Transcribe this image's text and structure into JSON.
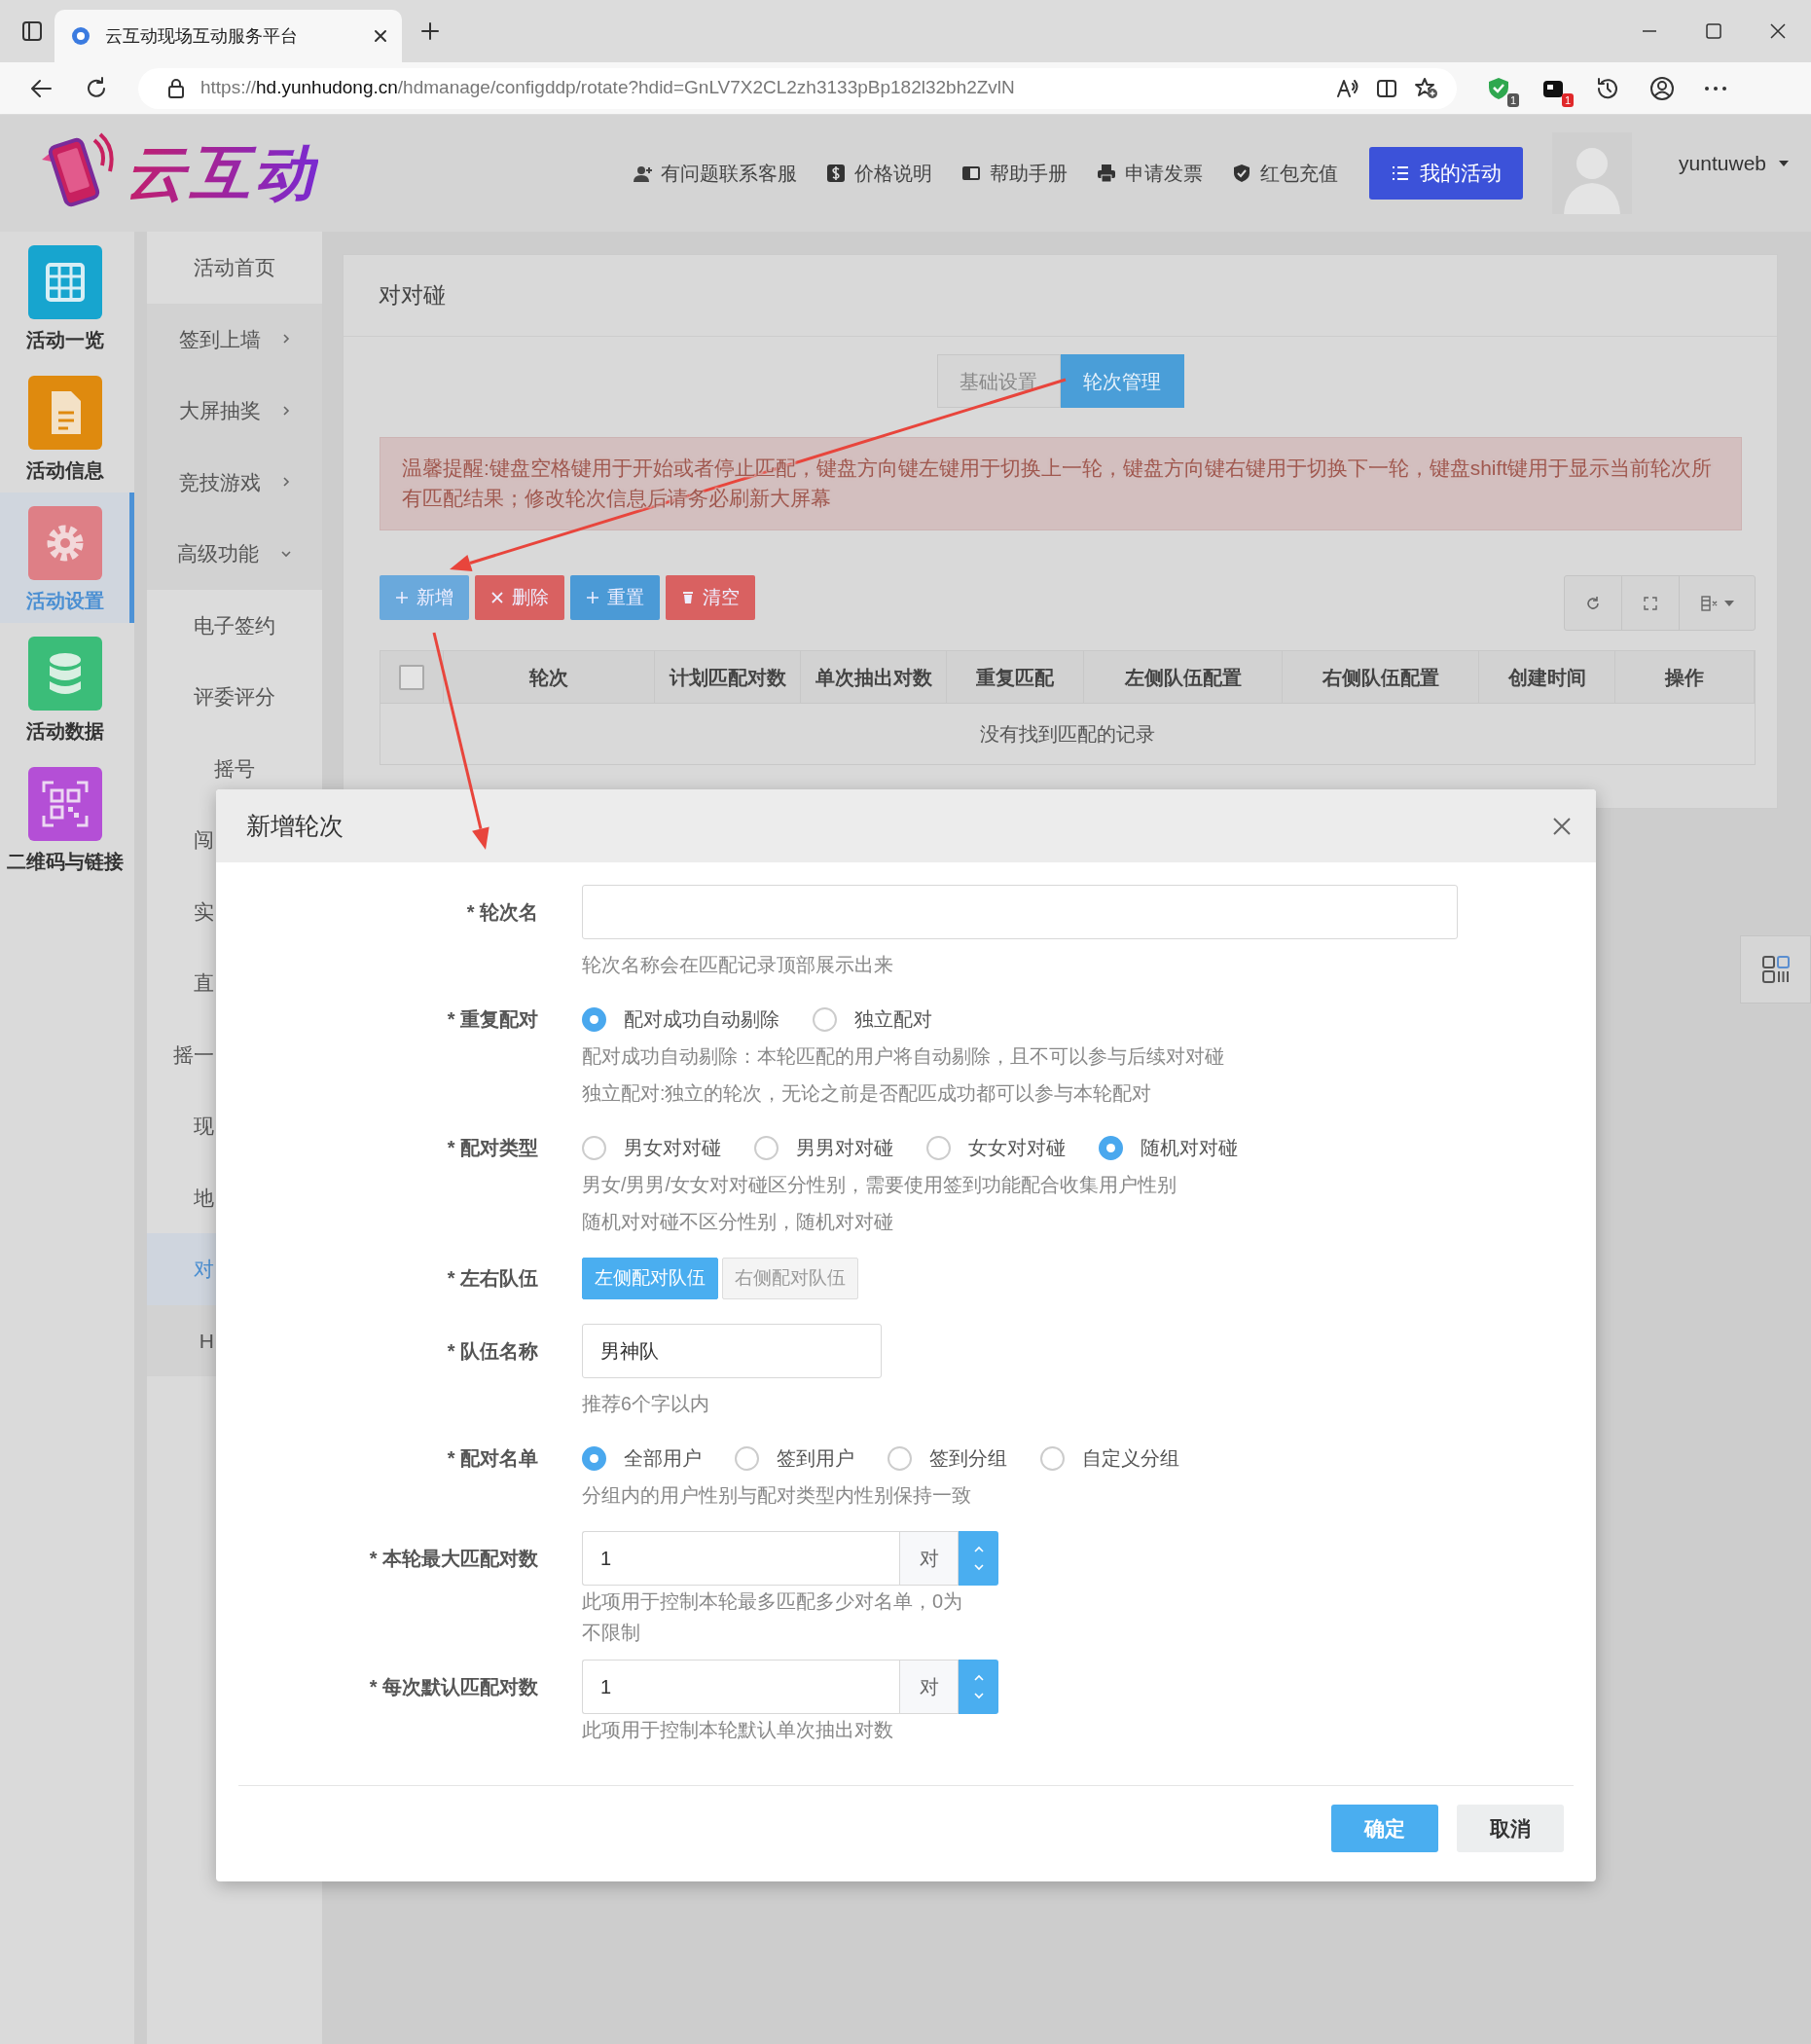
{
  "browser": {
    "tab_title": "云互动现场互动服务平台",
    "url_scheme": "https://",
    "url_host": "hd.yunhudong.cn",
    "url_path": "/hdmanage/configddp/rotate?hdid=GnLV7X2CL2zh3133pBp182l32bh2ZvlN",
    "extensions": [
      {
        "kind": "shield",
        "badge": "1"
      },
      {
        "kind": "app",
        "badge": "1"
      }
    ]
  },
  "header": {
    "logo_text": "云互动",
    "links": [
      {
        "kind": "contact",
        "label": "有问题联系客服"
      },
      {
        "kind": "price",
        "label": "价格说明"
      },
      {
        "kind": "manual",
        "label": "帮助手册"
      },
      {
        "kind": "invoice",
        "label": "申请发票"
      },
      {
        "kind": "redpacket",
        "label": "红包充值"
      }
    ],
    "activity_button": "我的活动",
    "username": "yuntuweb"
  },
  "icon_sidebar": [
    {
      "kind": "grid",
      "label": "活动一览",
      "color": "#17a5cf",
      "selected": false
    },
    {
      "kind": "document",
      "label": "活动信息",
      "color": "#df8a0e",
      "selected": false
    },
    {
      "kind": "gear",
      "label": "活动设置",
      "color": "#de7f86",
      "selected": true
    },
    {
      "kind": "database",
      "label": "活动数据",
      "color": "#3bbd79",
      "selected": false
    },
    {
      "kind": "qrcode",
      "label": "二维码与链接",
      "color": "#b44fd6",
      "selected": false
    }
  ],
  "menu": [
    {
      "kind": "link",
      "label": "活动首页",
      "selected": false
    },
    {
      "kind": "group",
      "label": "签到上墙",
      "expanded": false,
      "selected": false
    },
    {
      "kind": "group",
      "label": "大屏抽奖",
      "expanded": false,
      "selected": false
    },
    {
      "kind": "group",
      "label": "竞技游戏",
      "expanded": false,
      "selected": false
    },
    {
      "kind": "group",
      "label": "高级功能",
      "expanded": true,
      "selected": false,
      "children": [
        {
          "label": "电子签约",
          "selected": false
        },
        {
          "label": "评委评分",
          "selected": false
        },
        {
          "label": "摇号",
          "selected": false
        },
        {
          "label": "闯",
          "selected": false
        },
        {
          "label": "实",
          "selected": false
        },
        {
          "label": "直",
          "selected": false
        },
        {
          "label": "摇一",
          "selected": false
        },
        {
          "label": "现",
          "selected": false
        },
        {
          "label": "地",
          "selected": false
        },
        {
          "label": "对",
          "selected": true
        }
      ]
    },
    {
      "kind": "group",
      "label": "H",
      "selected": false
    }
  ],
  "panel": {
    "title": "对对碰",
    "tabs": [
      {
        "label": "基础设置",
        "selected": false
      },
      {
        "label": "轮次管理",
        "selected": true
      }
    ],
    "alert": "温馨提醒:键盘空格键用于开始或者停止匹配，键盘方向键左键用于切换上一轮，键盘方向键右键用于切换下一轮，键盘shift键用于显示当前轮次所有匹配结果；修改轮次信息后请务必刷新大屏幕",
    "toolbar": [
      {
        "kind": "add",
        "label": "新增"
      },
      {
        "kind": "delete",
        "label": "删除"
      },
      {
        "kind": "reset",
        "label": "重置"
      },
      {
        "kind": "clear",
        "label": "清空"
      }
    ],
    "table": {
      "select_all": false,
      "columns": [
        "轮次",
        "计划匹配对数",
        "单次抽出对数",
        "重复匹配",
        "左侧队伍配置",
        "右侧队伍配置",
        "创建时间",
        "操作"
      ],
      "empty_text": "没有找到匹配的记录"
    }
  },
  "modal": {
    "title": "新增轮次",
    "fields": [
      {
        "kind": "text",
        "label": "* 轮次名",
        "help": [
          "轮次名称会在匹配记录顶部展示出来"
        ]
      },
      {
        "kind": "radio",
        "label": "* 重复配对",
        "options": [
          {
            "label": "配对成功自动剔除",
            "selected": true
          },
          {
            "label": "独立配对",
            "selected": false
          }
        ],
        "help": [
          "配对成功自动剔除：本轮匹配的用户将自动剔除，且不可以参与后续对对碰",
          "独立配对:独立的轮次，无论之前是否配匹成功都可以参与本轮配对"
        ]
      },
      {
        "kind": "radio",
        "label": "* 配对类型",
        "options": [
          {
            "label": "男女对对碰",
            "selected": false
          },
          {
            "label": "男男对对碰",
            "selected": false
          },
          {
            "label": "女女对对碰",
            "selected": false
          },
          {
            "label": "随机对对碰",
            "selected": true
          }
        ],
        "help": [
          "男女/男男/女女对对碰区分性别，需要使用签到功能配合收集用户性别",
          "随机对对碰不区分性别，随机对对碰"
        ]
      },
      {
        "kind": "toggle",
        "label": "* 左右队伍",
        "options": [
          {
            "label": "左侧配对队伍",
            "selected": true
          },
          {
            "label": "右侧配对队伍",
            "selected": false
          }
        ]
      },
      {
        "kind": "text",
        "label": "* 队伍名称",
        "value": "男神队",
        "help": [
          "推荐6个字以内"
        ]
      },
      {
        "kind": "radio",
        "label": "* 配对名单",
        "options": [
          {
            "label": "全部用户",
            "selected": true
          },
          {
            "label": "签到用户",
            "selected": false
          },
          {
            "label": "签到分组",
            "selected": false
          },
          {
            "label": "自定义分组",
            "selected": false
          }
        ],
        "help": [
          "分组内的用户性别与配对类型内性别保持一致"
        ]
      },
      {
        "kind": "number",
        "label": "* 本轮最大匹配对数",
        "value": "1",
        "unit": "对",
        "help": [
          "此项用于控制本轮最多匹配多少对名单，0为不限制"
        ]
      },
      {
        "kind": "number",
        "label": "* 每次默认匹配对数",
        "value": "1",
        "unit": "对",
        "help": [
          "此项用于控制本轮默认单次抽出对数"
        ]
      }
    ],
    "buttons": [
      {
        "kind": "primary",
        "label": "确定"
      },
      {
        "kind": "secondary",
        "label": "取消"
      }
    ]
  }
}
